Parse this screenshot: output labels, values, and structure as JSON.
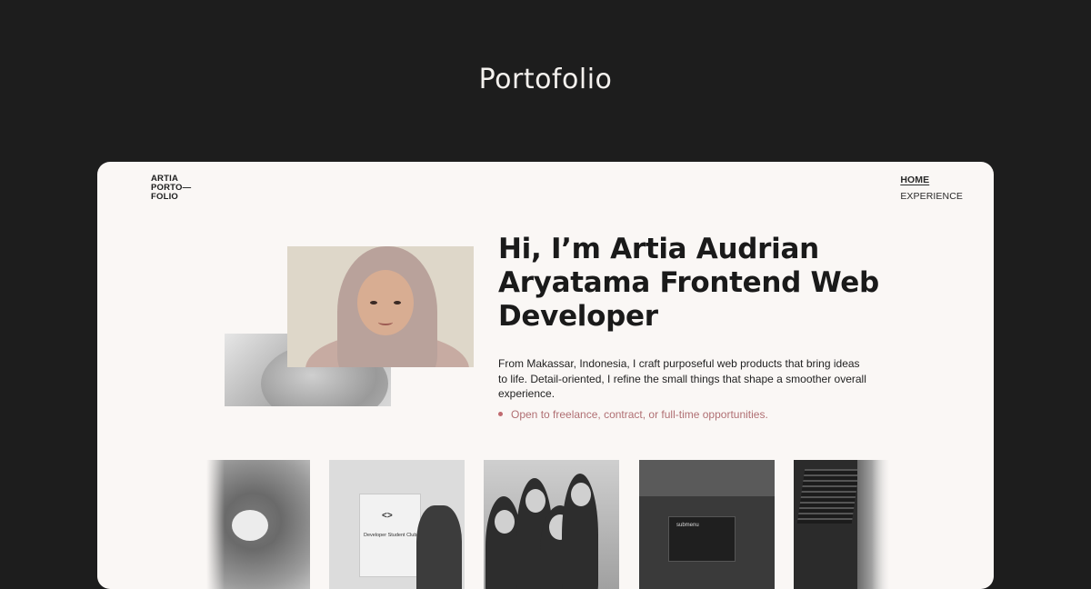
{
  "page": {
    "title": "Portofolio"
  },
  "header": {
    "logo_lines": [
      "ARTIA",
      "PORTO—",
      "FOLIO"
    ],
    "nav": [
      {
        "label": "HOME",
        "active": true
      },
      {
        "label": "EXPERIENCE",
        "active": false
      }
    ]
  },
  "hero": {
    "headline": "Hi, I’m Artia Audrian Aryatama Frontend Web Developer",
    "bio": "From Makassar, Indonesia, I craft purposeful web products that bring ideas to life. Detail-oriented, I refine the small things that shape a smoother overall experience.",
    "availability": "Open to freelance, contract, or full-time opportunities."
  },
  "gallery": {
    "photo2_logo": "<>",
    "photo2_banner_text": "Developer Student Clubs",
    "photo4_screen_text": "submenu"
  },
  "colors": {
    "background": "#1d1d1d",
    "card": "#faf7f5",
    "accent": "#b06f73",
    "text": "#1a1a1a"
  }
}
